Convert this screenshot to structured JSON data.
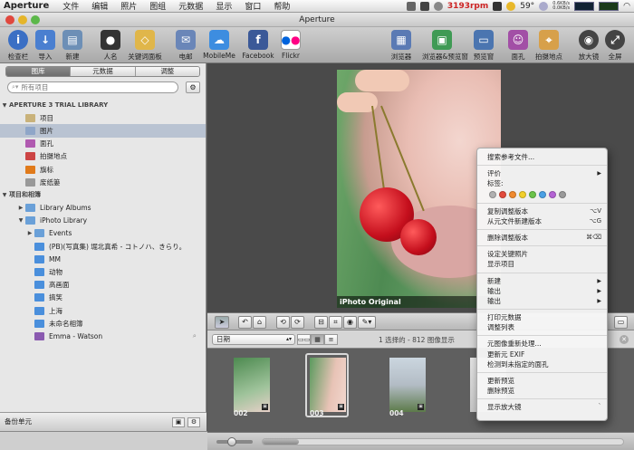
{
  "menubar": {
    "app": "Aperture",
    "items": [
      "文件",
      "编辑",
      "照片",
      "图组",
      "元数据",
      "显示",
      "窗口",
      "帮助"
    ],
    "fan_speed": "3193rpm",
    "temperature": "59°",
    "net_up": "0.6KB/s",
    "net_down": "0.0KB/s"
  },
  "window": {
    "title": "Aperture"
  },
  "toolbar": {
    "left": [
      {
        "label": "检查栏",
        "icon": "info-icon",
        "color": "#3b6fc4"
      },
      {
        "label": "导入",
        "icon": "import-arrow-icon",
        "color": "#4a7fd0"
      },
      {
        "label": "新建",
        "icon": "new-project-icon",
        "color": "#6d8fb6"
      },
      {
        "label": "人名",
        "icon": "person-icon",
        "color": "#333333"
      },
      {
        "label": "关键词面板",
        "icon": "keyword-tag-icon",
        "color": "#e0b64a"
      },
      {
        "label": "电邮",
        "icon": "mail-icon",
        "color": "#6a86b8"
      },
      {
        "label": "MobileMe",
        "icon": "cloud-icon",
        "color": "#3d8de0"
      },
      {
        "label": "Facebook",
        "icon": "facebook-icon",
        "color": "#3b5998"
      },
      {
        "label": "Flickr",
        "icon": "flickr-icon",
        "color": "#4060c0"
      }
    ],
    "right": [
      {
        "label": "浏览器",
        "icon": "browser-grid-icon",
        "color": "#5a7ab4"
      },
      {
        "label": "浏览器&预览窗",
        "icon": "browser-viewer-icon",
        "color": "#3f9a54"
      },
      {
        "label": "预览窗",
        "icon": "viewer-icon",
        "color": "#4b75b0"
      },
      {
        "label": "面孔",
        "icon": "faces-icon",
        "color": "#a24fa6"
      },
      {
        "label": "拍摄地点",
        "icon": "places-map-icon",
        "color": "#d7a04a"
      },
      {
        "label": "放大镜",
        "icon": "loupe-icon",
        "color": "#444444"
      },
      {
        "label": "全屏",
        "icon": "fullscreen-icon",
        "color": "#444444"
      }
    ]
  },
  "sidebar": {
    "tabs": [
      "图库",
      "元数据",
      "调整"
    ],
    "search_placeholder": "所有项目",
    "library_header": "APERTURE 3 TRIAL LIBRARY",
    "library_items": [
      {
        "label": "项目",
        "icon": "projects-icon",
        "color": "#c9b27a"
      },
      {
        "label": "图片",
        "icon": "photos-icon",
        "color": "#8fa6c8"
      },
      {
        "label": "面孔",
        "icon": "faces-icon",
        "color": "#b05ab0"
      },
      {
        "label": "拍摄地点",
        "icon": "places-icon",
        "color": "#c44"
      },
      {
        "label": "旗标",
        "icon": "flag-icon",
        "color": "#e07a1a"
      },
      {
        "label": "废纸篓",
        "icon": "trash-icon",
        "color": "#999999"
      }
    ],
    "projects_header": "项目和相簿",
    "project_items": [
      {
        "label": "Library Albums",
        "icon": "folder-icon",
        "color": "#6aa0d8",
        "tri": "▶",
        "indent": 1
      },
      {
        "label": "iPhoto Library",
        "icon": "folder-icon",
        "color": "#6aa0d8",
        "tri": "▼",
        "indent": 1
      },
      {
        "label": "Events",
        "icon": "folder-icon",
        "color": "#6aa0d8",
        "tri": "▶",
        "indent": 2
      },
      {
        "label": "(PB)(写真集) 堀北真希 - コトノハ、きらり。",
        "icon": "album-icon",
        "color": "#4a8fdc",
        "tri": "",
        "indent": 2
      },
      {
        "label": "MM",
        "icon": "album-icon",
        "color": "#4a8fdc",
        "tri": "",
        "indent": 2
      },
      {
        "label": "动物",
        "icon": "album-icon",
        "color": "#4a8fdc",
        "tri": "",
        "indent": 2
      },
      {
        "label": "高画面",
        "icon": "album-icon",
        "color": "#4a8fdc",
        "tri": "",
        "indent": 2
      },
      {
        "label": "搞笑",
        "icon": "album-icon",
        "color": "#4a8fdc",
        "tri": "",
        "indent": 2
      },
      {
        "label": "上海",
        "icon": "album-icon",
        "color": "#4a8fdc",
        "tri": "",
        "indent": 2
      },
      {
        "label": "未命名相簿",
        "icon": "album-icon",
        "color": "#4a8fdc",
        "tri": "",
        "indent": 2
      },
      {
        "label": "Emma - Watson",
        "icon": "smart-album-icon",
        "color": "#8a5ab0",
        "tri": "",
        "indent": 2
      }
    ],
    "footer_label": "备份单元"
  },
  "viewer": {
    "caption": "iPhoto Original"
  },
  "browser": {
    "sort_label": "日期",
    "selection_info": "1 选择的 - 812 图像显示"
  },
  "filmstrip": {
    "thumbs": [
      {
        "num": "002",
        "selected": false,
        "bg": "linear-gradient(160deg,#4d8a50,#9fc39b 60%,#e7d0c8)"
      },
      {
        "num": "003",
        "selected": true,
        "bg": "linear-gradient(100deg,#5a9a5e,#e8c3b6 60%,#f2d8cf)"
      },
      {
        "num": "004",
        "selected": false,
        "bg": "linear-gradient(180deg,#cbd6df,#b3bcc5 50%,#5c7a4a)"
      },
      {
        "num": "",
        "selected": false,
        "bg": "linear-gradient(180deg,#e6e6e6,#c9c9c9)"
      }
    ]
  },
  "context_menu": {
    "groups": [
      [
        {
          "label": "搜索参考文件..."
        }
      ],
      [
        {
          "label": "评价",
          "arrow": true
        },
        {
          "label": "标签:",
          "dots": true
        }
      ],
      [
        {
          "label": "复制调整版本",
          "shortcut": "⌥V"
        },
        {
          "label": "从元文件新建版本",
          "shortcut": "⌥G"
        }
      ],
      [
        {
          "label": "删除调整版本",
          "shortcut": "⌘⌫"
        }
      ],
      [
        {
          "label": "设定关键照片"
        },
        {
          "label": "显示项目"
        }
      ],
      [
        {
          "label": "新建",
          "arrow": true
        },
        {
          "label": "输出",
          "arrow": true
        },
        {
          "label": "输出",
          "arrow": true
        }
      ],
      [
        {
          "label": "打印元数据"
        },
        {
          "label": "调整列表"
        }
      ],
      [
        {
          "label": "元图像重新处理..."
        },
        {
          "label": "更新元 EXIF"
        },
        {
          "label": "检测到未指定的面孔"
        }
      ],
      [
        {
          "label": "更新预览"
        },
        {
          "label": "删除预览"
        }
      ],
      [
        {
          "label": "显示放大镜",
          "shortcut": "`"
        }
      ]
    ],
    "label_colors": [
      "#b0b0b0",
      "#e24a3c",
      "#f08a2e",
      "#f2cf2a",
      "#6ac24a",
      "#4aa0e4",
      "#b463d4",
      "#9a9a9a"
    ]
  }
}
